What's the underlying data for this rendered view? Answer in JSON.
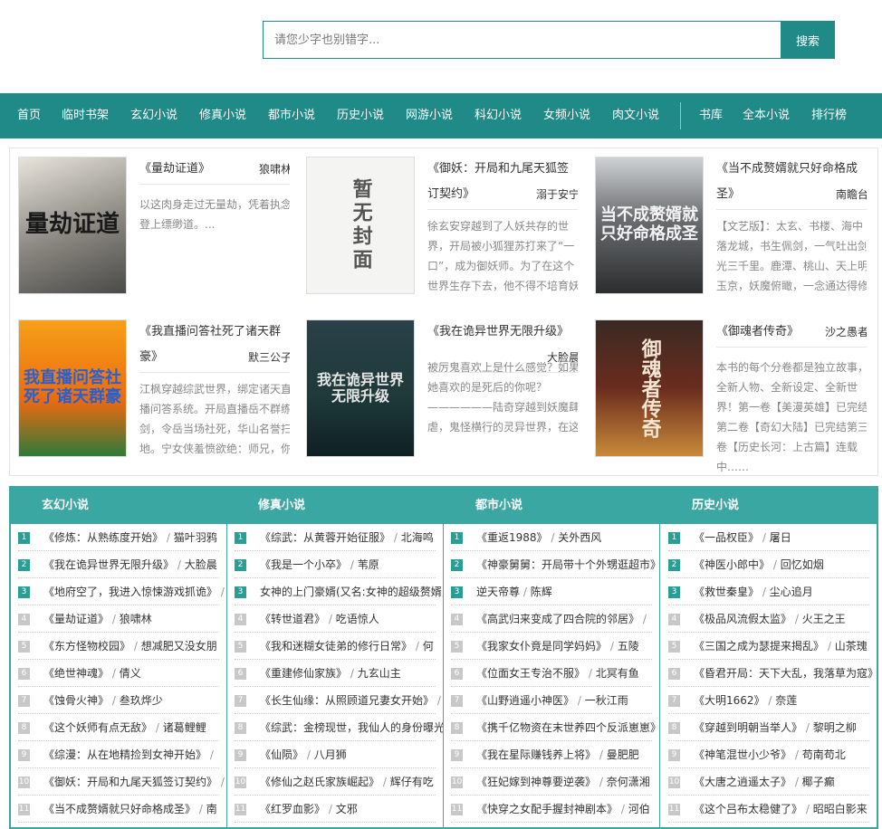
{
  "search": {
    "placeholder": "请您少字也别错字...",
    "button": "搜索"
  },
  "nav": {
    "items": [
      "首页",
      "临时书架",
      "玄幻小说",
      "修真小说",
      "都市小说",
      "历史小说",
      "网游小说",
      "科幻小说",
      "女频小说",
      "肉文小说"
    ],
    "right_items": [
      "书库",
      "全本小说",
      "排行榜"
    ]
  },
  "featured": [
    {
      "cover_text": "量劫证道",
      "title": "《量劫证道》",
      "author": "狼啸林",
      "desc": "以这肉身走过无量劫，凭着执念登上缥缈道。..."
    },
    {
      "cover_text": "暂无封面",
      "title": "《御妖：开局和九尾天狐签订契约》",
      "author": "溺于安宁",
      "desc": "徐玄安穿越到了人妖共存的世界，开局被小狐狸苏打来了“一口”，成为御妖师。为了在这个世界生存下去，他不得不培育妖将，强化己身。九色鹿、画皮、"
    },
    {
      "cover_text": "当不成赘婿就只好命格成圣",
      "title": "《当不成赘婿就只好命格成圣》",
      "author": "南瞻台",
      "desc": "【文艺版】：太玄、书楼、海中落龙城，书生佩剑，一气吐出剑光三千里。鹿潭、桃山、天上明玉京，妖魔俯瞰，一念通达得修八百年。这一年，北方有酒客"
    },
    {
      "cover_text": "我直播问答社死了诸天群豪",
      "title": "《我直播问答社死了诸天群豪》",
      "author": "默三公子",
      "desc": "江枫穿越综武世界，绑定诸天直播问答系统。开局直播岳不群练剑，令岳当场社死，华山名誉扫地。宁女侠羞愤欲绝：师兄，你竟然……岳不群欲哭无泪，他"
    },
    {
      "cover_text": "我在诡异世界无限升级",
      "title": "《我在诡异世界无限升级》",
      "author": "大脸晨",
      "desc": "被厉鬼喜欢上是什么感觉？如果她喜欢的是死后的你呢？——————陆奇穿越到妖魔肆虐，鬼怪横行的灵异世界，在这里处处都是危机，在这里随时"
    },
    {
      "cover_text": "御魂者传奇",
      "title": "《御魂者传奇》",
      "author": "沙之愚者",
      "desc": "本书的每个分卷都是独立故事，全新人物、全新设定、全新世界！第一卷【美漫英雄】已完结第二卷【奇幻大陆】已完结第三卷【历史长河：上古篇】连载中……"
    }
  ],
  "ranking": [
    {
      "title": "玄幻小说",
      "rows": [
        {
          "num": "1",
          "book": "《修炼：从熟练度开始》",
          "author": "猫叶羽鸦"
        },
        {
          "num": "2",
          "book": "《我在诡异世界无限升级》",
          "author": "大脸晨"
        },
        {
          "num": "3",
          "book": "《地府空了，我进入惊悚游戏抓诡》",
          "author": ""
        },
        {
          "num": "4",
          "book": "《量劫证道》",
          "author": "狼啸林"
        },
        {
          "num": "5",
          "book": "《东方怪物校园》",
          "author": "想减肥又没女朋"
        },
        {
          "num": "6",
          "book": "《绝世神魂》",
          "author": "倩义"
        },
        {
          "num": "7",
          "book": "《蚀骨火神》",
          "author": "叁玖烨少"
        },
        {
          "num": "8",
          "book": "《这个妖师有点无敌》",
          "author": "诸葛鲤鲤"
        },
        {
          "num": "9",
          "book": "《综漫：从在地精捡到女神开始》",
          "author": ""
        },
        {
          "num": "10",
          "book": "《御妖：开局和九尾天狐签订契约》",
          "author": ""
        },
        {
          "num": "11",
          "book": "《当不成赘婿就只好命格成圣》",
          "author": "南"
        }
      ]
    },
    {
      "title": "修真小说",
      "rows": [
        {
          "num": "1",
          "book": "《综武：从黄蓉开始征服》",
          "author": "北海鸣"
        },
        {
          "num": "2",
          "book": "《我是一个小卒》",
          "author": "苇原"
        },
        {
          "num": "3",
          "book": "女神的上门豪婿(又名:女神的超级赘婿,",
          "author": ""
        },
        {
          "num": "4",
          "book": "《转世道君》",
          "author": "吃语惊人"
        },
        {
          "num": "5",
          "book": "《我和迷糊女徒弟的修行日常》",
          "author": "何"
        },
        {
          "num": "6",
          "book": "《重建修仙家族》",
          "author": "九玄山主"
        },
        {
          "num": "7",
          "book": "《长生仙缘：从照顾道兄妻女开始》",
          "author": ""
        },
        {
          "num": "8",
          "book": "《综武：金榜现世，我仙人的身份曝光",
          "author": ""
        },
        {
          "num": "9",
          "book": "《仙陨》",
          "author": "八月狮"
        },
        {
          "num": "10",
          "book": "《修仙之赵氏家族崛起》",
          "author": "辉仔有吃"
        },
        {
          "num": "11",
          "book": "《红罗血影》",
          "author": "文邪"
        }
      ]
    },
    {
      "title": "都市小说",
      "rows": [
        {
          "num": "1",
          "book": "《重返1988》",
          "author": "关外西风"
        },
        {
          "num": "2",
          "book": "《神豪舅舅：开局带十个外甥逛超市》",
          "author": ""
        },
        {
          "num": "3",
          "book": "逆天帝尊",
          "author": "陈辉"
        },
        {
          "num": "4",
          "book": "《高武归来变成了四合院的邻居》",
          "author": ""
        },
        {
          "num": "5",
          "book": "《我家女仆竟是同学妈妈》",
          "author": "五陵"
        },
        {
          "num": "6",
          "book": "《位面女王专治不服》",
          "author": "北冥有鱼"
        },
        {
          "num": "7",
          "book": "《山野逍遥小神医》",
          "author": "一秋江雨"
        },
        {
          "num": "8",
          "book": "《携千亿物资在末世养四个反派崽崽》",
          "author": ""
        },
        {
          "num": "9",
          "book": "《我在星际赚钱养上将》",
          "author": "曼肥肥"
        },
        {
          "num": "10",
          "book": "《狂妃嫁到神尊要逆袭》",
          "author": "奈何潇湘"
        },
        {
          "num": "11",
          "book": "《快穿之女配手握封神剧本》",
          "author": "河伯"
        }
      ]
    },
    {
      "title": "历史小说",
      "rows": [
        {
          "num": "1",
          "book": "《一品权臣》",
          "author": "屠日"
        },
        {
          "num": "2",
          "book": "《神医小郎中》",
          "author": "回忆如烟"
        },
        {
          "num": "3",
          "book": "《救世秦皇》",
          "author": "尘心追月"
        },
        {
          "num": "4",
          "book": "《极品风流假太监》",
          "author": "火王之王"
        },
        {
          "num": "5",
          "book": "《三国之成为瑟提来揭乱》",
          "author": "山茶瑰"
        },
        {
          "num": "6",
          "book": "《昏君开局：天下大乱，我落草为寇》",
          "author": ""
        },
        {
          "num": "7",
          "book": "《大明1662》",
          "author": "奈莲"
        },
        {
          "num": "8",
          "book": "《穿越到明朝当举人》",
          "author": "黎明之柳"
        },
        {
          "num": "9",
          "book": "《神笔混世小少爷》",
          "author": "苟南苟北"
        },
        {
          "num": "10",
          "book": "《大唐之逍遥太子》",
          "author": "椰子癫"
        },
        {
          "num": "11",
          "book": "《这个吕布太稳健了》",
          "author": "昭昭白影来"
        }
      ]
    }
  ],
  "colors": {
    "accent": "#1f8a87",
    "rank_header": "#3aa7a3",
    "rank_num_top": "#2a9d94"
  }
}
